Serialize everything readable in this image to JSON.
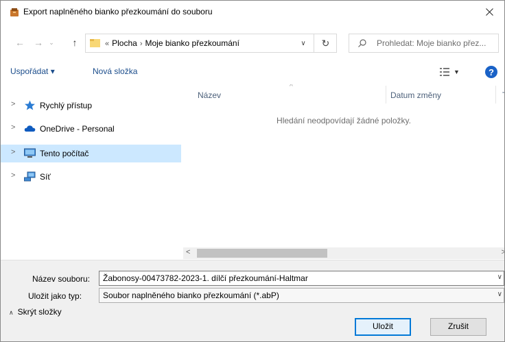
{
  "window": {
    "title": "Export naplněného bianko přezkoumání do souboru"
  },
  "address": {
    "crumbs": [
      "Plocha",
      "Moje bianko přezkoumání"
    ],
    "overflow": "«",
    "separator": "›"
  },
  "search": {
    "placeholder": "Prohledat: Moje bianko přez..."
  },
  "toolbar": {
    "organize": "Uspořádat ▾",
    "new_folder": "Nová složka"
  },
  "nav": {
    "items": [
      {
        "label": "Rychlý přístup",
        "icon": "star-icon",
        "selected": false
      },
      {
        "label": "OneDrive - Personal",
        "icon": "cloud-icon",
        "selected": false
      },
      {
        "label": "Tento počítač",
        "icon": "computer-icon",
        "selected": true
      },
      {
        "label": "Síť",
        "icon": "network-icon",
        "selected": false
      }
    ]
  },
  "files": {
    "col_name": "Název",
    "col_date": "Datum změny",
    "col_type": "T",
    "empty_message": "Hledání neodpovídají žádné položky."
  },
  "form": {
    "filename_label": "Název souboru:",
    "filename_value": "Žabonosy-00473782-2023-1. dílčí přezkoumání-Haltmar",
    "filetype_label": "Uložit jako typ:",
    "filetype_value": "Soubor naplněného bianko přezkoumání (*.abP)"
  },
  "footer": {
    "hide_folders": "Skrýt složky",
    "save": "Uložit",
    "cancel": "Zrušit"
  },
  "colors": {
    "accent": "#0078d7",
    "selection": "#cce8ff",
    "link": "#1a4c8b"
  }
}
